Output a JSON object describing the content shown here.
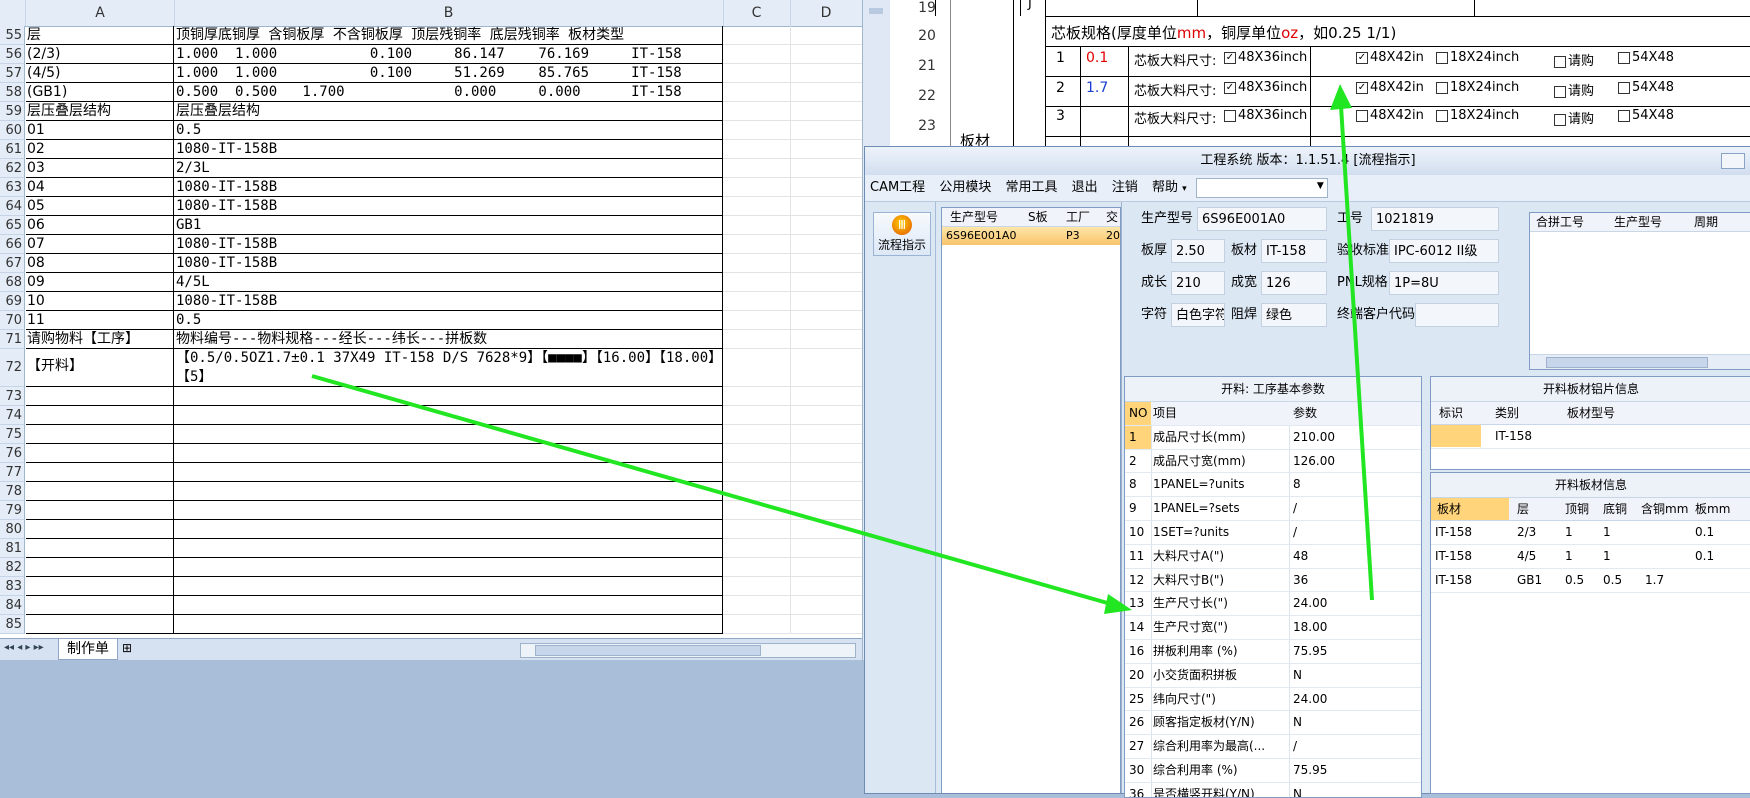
{
  "excel": {
    "col_headers": [
      "A",
      "B",
      "C",
      "D"
    ],
    "sheet_tab": "制作单",
    "rows": [
      {
        "n": "55",
        "a": "层",
        "b": "顶铜厚底铜厚 含铜板厚 不含铜板厚 顶层残铜率 底层残铜率 板材类型"
      },
      {
        "n": "56",
        "a": "(2/3)",
        "b": "1.000  1.000           0.100     86.147    76.169     IT-158"
      },
      {
        "n": "57",
        "a": "(4/5)",
        "b": "1.000  1.000           0.100     51.269    85.765     IT-158"
      },
      {
        "n": "58",
        "a": "(GB1)",
        "b": "0.500  0.500   1.700             0.000     0.000      IT-158"
      },
      {
        "n": "59",
        "a": "层压叠层结构",
        "b": "层压叠层结构"
      },
      {
        "n": "60",
        "a": "01",
        "b": "0.5"
      },
      {
        "n": "61",
        "a": "02",
        "b": "1080-IT-158B"
      },
      {
        "n": "62",
        "a": "03",
        "b": "2/3L"
      },
      {
        "n": "63",
        "a": "04",
        "b": "1080-IT-158B"
      },
      {
        "n": "64",
        "a": "05",
        "b": "1080-IT-158B"
      },
      {
        "n": "65",
        "a": "06",
        "b": "GB1"
      },
      {
        "n": "66",
        "a": "07",
        "b": "1080-IT-158B"
      },
      {
        "n": "67",
        "a": "08",
        "b": "1080-IT-158B"
      },
      {
        "n": "68",
        "a": "09",
        "b": "4/5L"
      },
      {
        "n": "69",
        "a": "10",
        "b": "1080-IT-158B"
      },
      {
        "n": "70",
        "a": "11",
        "b": "0.5"
      },
      {
        "n": "71",
        "a": "请购物料【工序】",
        "b": "物料编号---物料规格---经长---纬长---拼板数"
      },
      {
        "n": "72",
        "a": "【开料】",
        "b": "【0.5/0.5OZ1.7±0.1  37X49  IT-158 D/S 7628*9】【■■■■】【16.00】【18.00】【5】"
      },
      {
        "n": "73",
        "a": "",
        "b": ""
      },
      {
        "n": "74",
        "a": "",
        "b": ""
      },
      {
        "n": "75",
        "a": "",
        "b": ""
      },
      {
        "n": "76",
        "a": "",
        "b": ""
      },
      {
        "n": "77",
        "a": "",
        "b": ""
      },
      {
        "n": "78",
        "a": "",
        "b": ""
      },
      {
        "n": "79",
        "a": "",
        "b": ""
      },
      {
        "n": "80",
        "a": "",
        "b": ""
      },
      {
        "n": "81",
        "a": "",
        "b": ""
      },
      {
        "n": "82",
        "a": "",
        "b": ""
      },
      {
        "n": "83",
        "a": "",
        "b": ""
      },
      {
        "n": "84",
        "a": "",
        "b": ""
      },
      {
        "n": "85",
        "a": "",
        "b": ""
      }
    ]
  },
  "word": {
    "line_numbers": [
      "19",
      "20",
      "21",
      "22",
      "23"
    ],
    "cell_j": "J",
    "spec_title": "芯板规格(厚度单位",
    "spec_unit_mm": "mm",
    "spec_mid": "，铜厚单位",
    "spec_unit_oz": "oz",
    "spec_tail": "，如0.25 1/1)",
    "side_label": "板材",
    "rows": [
      {
        "no": "1",
        "val": "0.1",
        "val_color": "#e00000",
        "label": "芯板大料尺寸:",
        "o1": "48X36inch",
        "o1c": true,
        "o2": "48X42in",
        "o2c": true,
        "o3": "18X24inch",
        "o3c": false,
        "o4": "请购",
        "o5": "54X48"
      },
      {
        "no": "2",
        "val": "1.7",
        "val_color": "#1a3fd0",
        "label": "芯板大料尺寸:",
        "o1": "48X36inch",
        "o1c": true,
        "o2": "48X42in",
        "o2c": true,
        "o3": "18X24inch",
        "o3c": false,
        "o4": "请购",
        "o5": "54X48"
      },
      {
        "no": "3",
        "val": "",
        "val_color": "#000000",
        "label": "芯板大料尺寸:",
        "o1": "48X36inch",
        "o1c": false,
        "o2": "48X42in",
        "o2c": false,
        "o3": "18X24inch",
        "o3c": false,
        "o4": "请购",
        "o5": "54X48"
      }
    ]
  },
  "cam": {
    "title": "工程系统  版本：1.1.51.4  [流程指示]",
    "menu": [
      "CAM工程",
      "公用模块",
      "常用工具",
      "退出",
      "注销",
      "帮助"
    ],
    "flow_button": "流程指示",
    "list": {
      "headers": [
        "生产型号",
        "S板",
        "工厂",
        "交"
      ],
      "row": [
        "6S96E001A0",
        "",
        "P3",
        "20"
      ]
    },
    "info": {
      "prod_model_label": "生产型号",
      "prod_model": "6S96E001A0",
      "work_no_label": "工号",
      "work_no": "1021819",
      "thickness_label": "板厚",
      "thickness": "2.50",
      "board_label": "板材",
      "board": "IT-158",
      "standard_label": "验收标准",
      "standard": "IPC-6012 II级",
      "length_label": "成长",
      "length": "210",
      "width_label": "成宽",
      "width": "126",
      "pnl_label": "PNL规格",
      "pnl": "1P=8U",
      "char_label": "字符",
      "char": "白色字符",
      "solder_label": "阻焊",
      "solder": "绿色",
      "end_customer_label": "终端客户代码",
      "end_customer": ""
    },
    "merge_table": {
      "headers": [
        "合拼工号",
        "生产型号",
        "周期"
      ]
    },
    "params": {
      "title": "开料: 工序基本参数",
      "headers": [
        "NO",
        "项目",
        "参数"
      ],
      "rows": [
        [
          "1",
          "成品尺寸长(mm)",
          "210.00"
        ],
        [
          "2",
          "成品尺寸宽(mm)",
          "126.00"
        ],
        [
          "8",
          "1PANEL=?units",
          "8"
        ],
        [
          "9",
          "1PANEL=?sets",
          "/"
        ],
        [
          "10",
          "1SET=?units",
          "/"
        ],
        [
          "11",
          "大料尺寸A(\")",
          "48"
        ],
        [
          "12",
          "大料尺寸B(\")",
          "36"
        ],
        [
          "13",
          "生产尺寸长(\")",
          "24.00"
        ],
        [
          "14",
          "生产尺寸宽(\")",
          "18.00"
        ],
        [
          "16",
          "拼板利用率 (%)",
          "75.95"
        ],
        [
          "20",
          "小交货面积拼板",
          "N"
        ],
        [
          "25",
          "纬向尺寸(\")",
          "24.00"
        ],
        [
          "26",
          "顾客指定板材(Y/N)",
          "N"
        ],
        [
          "27",
          "综合利用率为最高(...",
          "/"
        ],
        [
          "30",
          "综合利用率 (%)",
          "75.95"
        ],
        [
          "36",
          "是否横竖开料(Y/N)",
          "N"
        ]
      ]
    },
    "cut_panel": {
      "title": "开料板材铝片信息",
      "headers": [
        "标识",
        "类别",
        "板材型号"
      ],
      "row": [
        "",
        "IT-158",
        ""
      ]
    },
    "mat_panel": {
      "title": "开料板材信息",
      "headers": [
        "板材",
        "层",
        "顶铜",
        "底铜",
        "含铜mm",
        "板mm"
      ],
      "rows": [
        [
          "IT-158",
          "2/3",
          "1",
          "1",
          "",
          "0.1"
        ],
        [
          "IT-158",
          "4/5",
          "1",
          "1",
          "",
          "0.1"
        ],
        [
          "IT-158",
          "GB1",
          "0.5",
          "0.5",
          "1.7",
          ""
        ]
      ]
    }
  },
  "colors": {
    "arrow": "#22e622",
    "accent_orange": "#ffd47a",
    "excel_header": "#e4ecf7"
  }
}
